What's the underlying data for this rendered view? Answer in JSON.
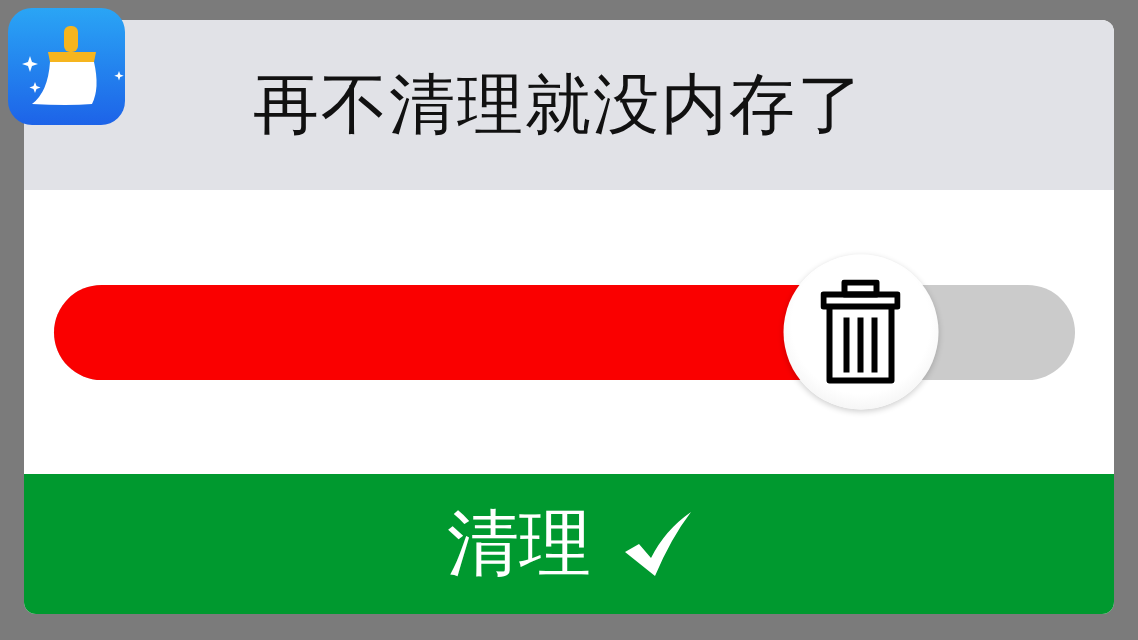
{
  "title": "再不清理就没内存了",
  "slider": {
    "level": 0.79
  },
  "button": {
    "label": "清理"
  }
}
